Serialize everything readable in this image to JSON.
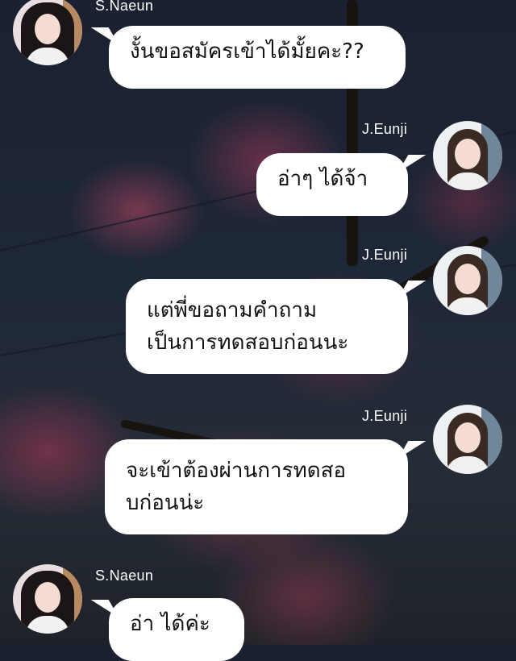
{
  "messages": [
    {
      "sender": "S.Naeun",
      "side": "left",
      "lines": [
        "งั้นขอสมัครเข้าได้มั้ยคะ??"
      ]
    },
    {
      "sender": "J.Eunji",
      "side": "right",
      "lines": [
        "อ่าๆ ได้จ้า"
      ]
    },
    {
      "sender": "J.Eunji",
      "side": "right",
      "lines": [
        "แต่พี่ขอถามคำถาม",
        "เป็นการทดสอบก่อนนะ"
      ]
    },
    {
      "sender": "J.Eunji",
      "side": "right",
      "lines": [
        "จะเข้าต้องผ่านการทดสอ",
        "บก่อนน่ะ"
      ]
    },
    {
      "sender": "S.Naeun",
      "side": "left",
      "lines": [
        "อ่า ได้ค่ะ"
      ]
    }
  ],
  "colors": {
    "bubble": "#ffffff",
    "text": "#121212",
    "name": "#ffffff"
  }
}
